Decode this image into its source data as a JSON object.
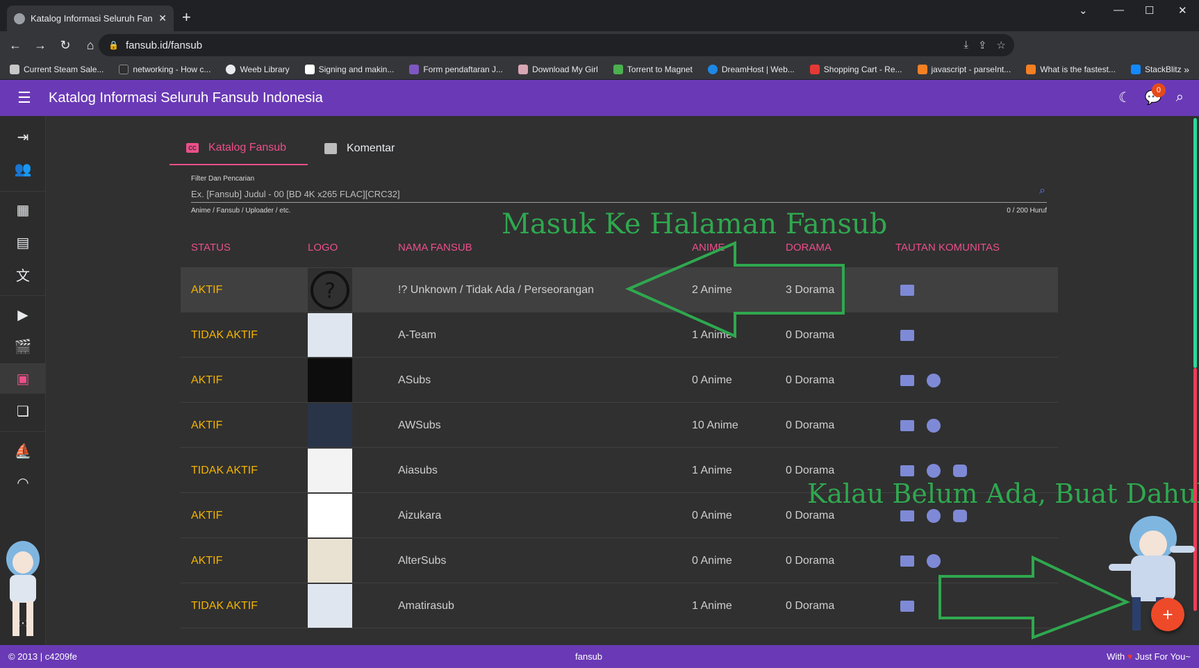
{
  "browser": {
    "tab_title": "Katalog Informasi Seluruh Fansub",
    "url": "fansub.id/fansub",
    "bookmarks": [
      "Current Steam Sale...",
      "networking - How c...",
      "Weeb Library",
      "Signing and makin...",
      "Form pendaftaran J...",
      "Download My Girl",
      "Torrent to Magnet",
      "DreamHost | Web...",
      "Shopping Cart - Re...",
      "javascript - parseInt...",
      "What is the fastest...",
      "StackBlitz"
    ],
    "bookmarks_more": "»"
  },
  "app": {
    "title": "Katalog Informasi Seluruh Fansub Indonesia",
    "notif_count": "0"
  },
  "tabs": [
    {
      "label": "Katalog Fansub",
      "icon": "cc-icon"
    },
    {
      "label": "Komentar",
      "icon": "comment-icon"
    }
  ],
  "filter": {
    "label": "Filter Dan Pencarian",
    "placeholder": "Ex. [Fansub] Judul - 00 [BD 4K x265 FLAC][CRC32]",
    "hint": "Anime / Fansub / Uploader / etc.",
    "counter": "0 / 200 Huruf"
  },
  "table": {
    "headers": [
      "STATUS",
      "LOGO",
      "NAMA FANSUB",
      "ANIME",
      "DORAMA",
      "TAUTAN KOMUNITAS"
    ],
    "rows": [
      {
        "status": "AKTIF",
        "name": "!? Unknown / Tidak Ada / Perseorangan",
        "anime": "2 Anime",
        "dorama": "3 Dorama",
        "links": [
          "web"
        ]
      },
      {
        "status": "TIDAK AKTIF",
        "name": "A-Team",
        "anime": "1 Anime",
        "dorama": "0 Dorama",
        "links": [
          "web"
        ]
      },
      {
        "status": "AKTIF",
        "name": "ASubs",
        "anime": "0 Anime",
        "dorama": "0 Dorama",
        "links": [
          "web",
          "facebook"
        ]
      },
      {
        "status": "AKTIF",
        "name": "AWSubs",
        "anime": "10 Anime",
        "dorama": "0 Dorama",
        "links": [
          "web",
          "facebook"
        ]
      },
      {
        "status": "TIDAK AKTIF",
        "name": "Aiasubs",
        "anime": "1 Anime",
        "dorama": "0 Dorama",
        "links": [
          "web",
          "facebook",
          "discord"
        ]
      },
      {
        "status": "AKTIF",
        "name": "Aizukara",
        "anime": "0 Anime",
        "dorama": "0 Dorama",
        "links": [
          "web",
          "facebook",
          "discord"
        ]
      },
      {
        "status": "AKTIF",
        "name": "AlterSubs",
        "anime": "0 Anime",
        "dorama": "0 Dorama",
        "links": [
          "web",
          "facebook"
        ]
      },
      {
        "status": "TIDAK AKTIF",
        "name": "Amatirasub",
        "anime": "1 Anime",
        "dorama": "0 Dorama",
        "links": [
          "web"
        ]
      }
    ]
  },
  "annotations": {
    "top": "Masuk Ke Halaman Fansub",
    "bottom": "Kalau Belum Ada, Buat Dahulu"
  },
  "fab_label": "+",
  "footer": {
    "left": "© 2013 | c4209fe",
    "center": "fansub",
    "right_prefix": "With",
    "right_suffix": "Just For You~"
  },
  "colors": {
    "appbar": "#6a3ab6",
    "accent": "#ec4f8a",
    "status": "#f4b400",
    "annotation": "#2fa84f"
  }
}
